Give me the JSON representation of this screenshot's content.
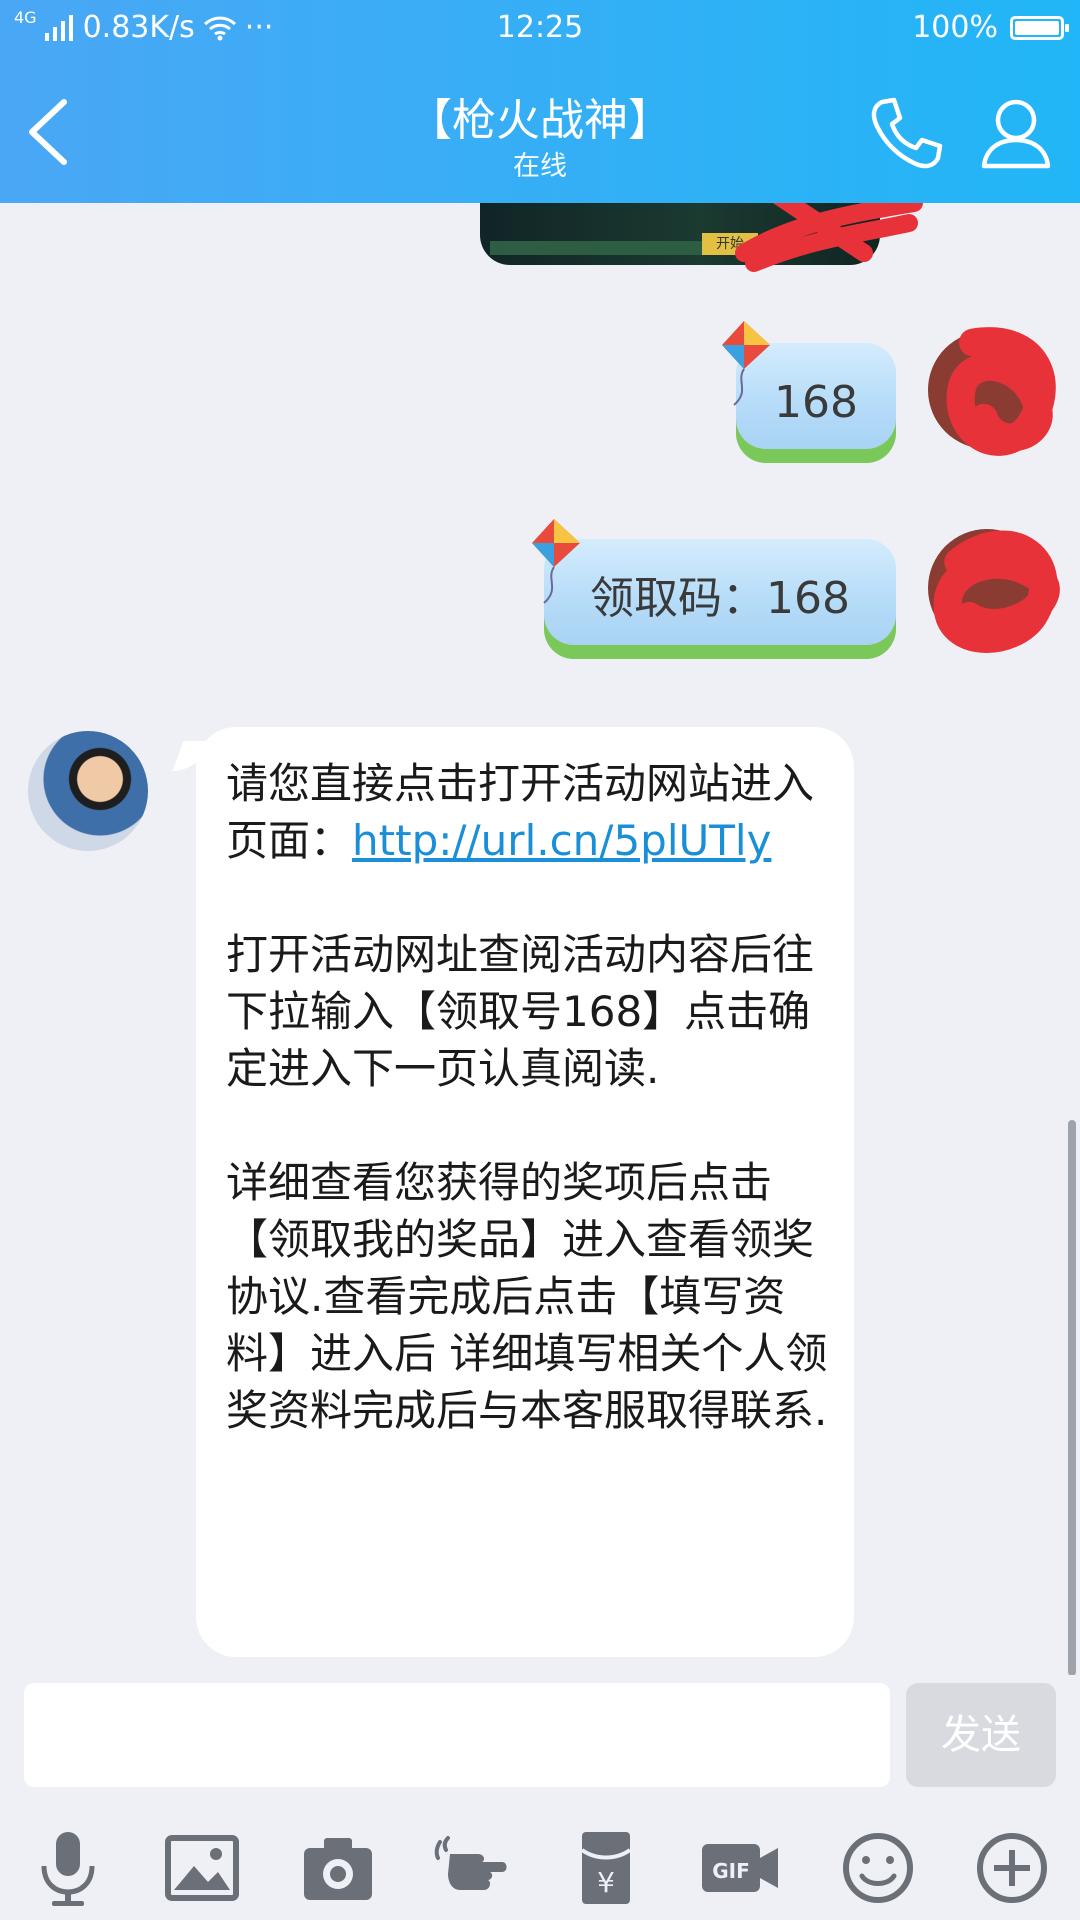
{
  "status": {
    "network": "4G",
    "speed": "0.83K/s",
    "more": "···",
    "time": "12:25",
    "battery": "100%",
    "battery_level": 1.0
  },
  "header": {
    "title": "【枪火战神】",
    "subtitle": "在线",
    "back_icon": "chevron-left-icon",
    "call_icon": "phone-icon",
    "profile_icon": "person-icon"
  },
  "messages": {
    "outgoing": [
      {
        "text": "168"
      },
      {
        "text": "领取码：168"
      }
    ],
    "incoming": {
      "p1_text": "请您直接点击打开活动网站进入页面：",
      "p1_link": "http://url.cn/5plUTly",
      "p2": "打开活动网址查阅活动内容后往下拉输入【领取号168】点击确定进入下一页认真阅读.",
      "p3": "详细查看您获得的奖项后点击【领取我的奖品】进入查看领奖协议.查看完成后点击【填写资料】进入后 详细填写相关个人领奖资料完成后与本客服取得联系."
    },
    "image_button": "开始"
  },
  "input": {
    "placeholder": "",
    "send_label": "发送"
  },
  "toolbar": {
    "icons": [
      "microphone-icon",
      "image-icon",
      "camera-icon",
      "poke-icon",
      "red-packet-icon",
      "gif-icon",
      "emoji-icon",
      "plus-icon"
    ]
  },
  "colors": {
    "header_start": "#4aa7f5",
    "header_end": "#21b6f7",
    "background": "#eef0f5",
    "link": "#1a8fd8",
    "scribble": "#e8323a"
  }
}
